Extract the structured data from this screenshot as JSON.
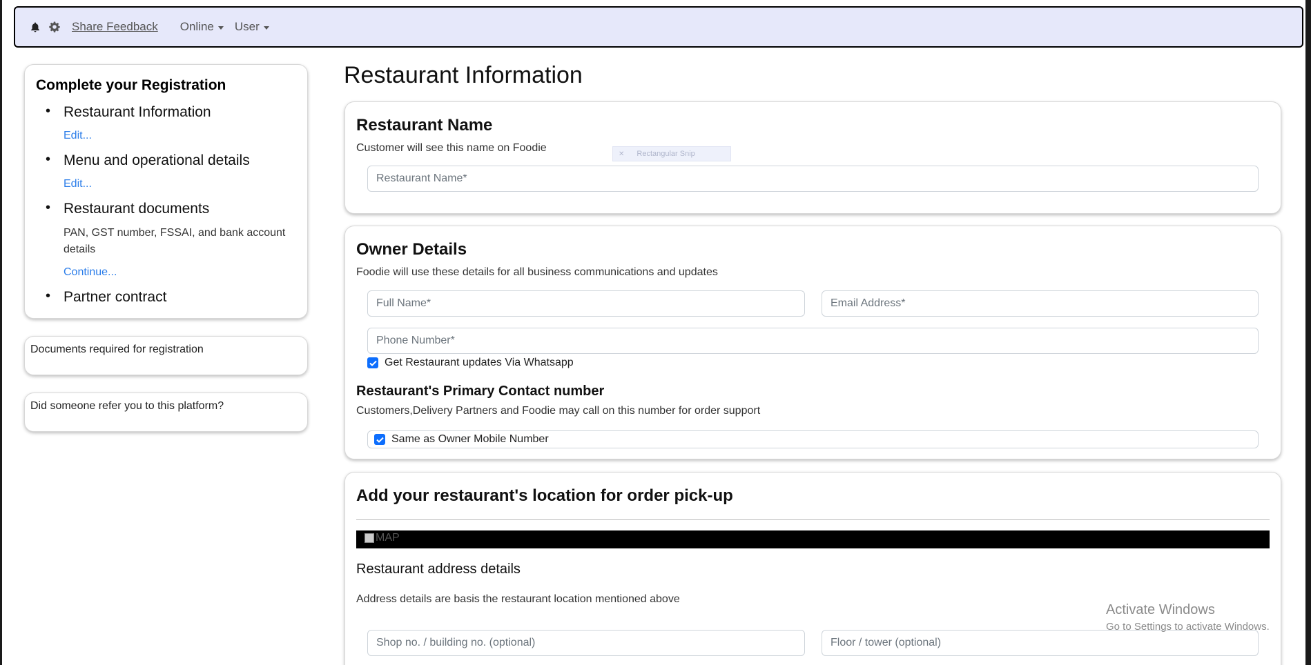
{
  "navbar": {
    "share_feedback": "Share Feedback",
    "status_dropdown": "Online",
    "user_dropdown": "User"
  },
  "sidebar": {
    "title": "Complete your Registration",
    "steps": [
      {
        "label": "Restaurant Information",
        "link": "Edit..."
      },
      {
        "label": "Menu and operational details",
        "link": "Edit..."
      },
      {
        "label": "Restaurant documents",
        "description": "PAN, GST number, FSSAI, and bank account details",
        "link": "Continue..."
      },
      {
        "label": "Partner contract"
      }
    ],
    "docs_required": "Documents required for registration",
    "referral": "Did someone refer you to this platform?"
  },
  "main": {
    "page_title": "Restaurant Information",
    "restaurant_name": {
      "heading": "Restaurant Name",
      "subtitle": "Customer will see this name on Foodie",
      "placeholder": "Restaurant Name*"
    },
    "owner": {
      "heading": "Owner Details",
      "subtitle": "Foodie will use these details for all business communications and updates",
      "full_name_placeholder": "Full Name*",
      "email_placeholder": "Email Address*",
      "phone_placeholder": "Phone Number*",
      "whatsapp_label": "Get Restaurant updates Via Whatsapp",
      "whatsapp_checked": true,
      "contact_heading": "Restaurant's Primary Contact number",
      "contact_subtitle": "Customers,Delivery Partners and Foodie may call on this number for order support",
      "same_as_owner_label": "Same as Owner Mobile Number",
      "same_as_owner_checked": true
    },
    "location": {
      "heading": "Add your restaurant's location for order pick-up",
      "map_alt": "MAP",
      "address_heading": "Restaurant address details",
      "address_subtitle": "Address details are basis the restaurant location mentioned above",
      "shop_placeholder": "Shop no. / building no. (optional)",
      "floor_placeholder": "Floor / tower (optional)"
    }
  },
  "overlay": {
    "snip_label": "Rectangular Snip"
  },
  "watermark": {
    "line1": "Activate Windows",
    "line2": "Go to Settings to activate Windows."
  },
  "colors": {
    "navbar_bg": "#e6e8fa",
    "link": "#2b7de9",
    "checkbox": "#0d6efd"
  }
}
